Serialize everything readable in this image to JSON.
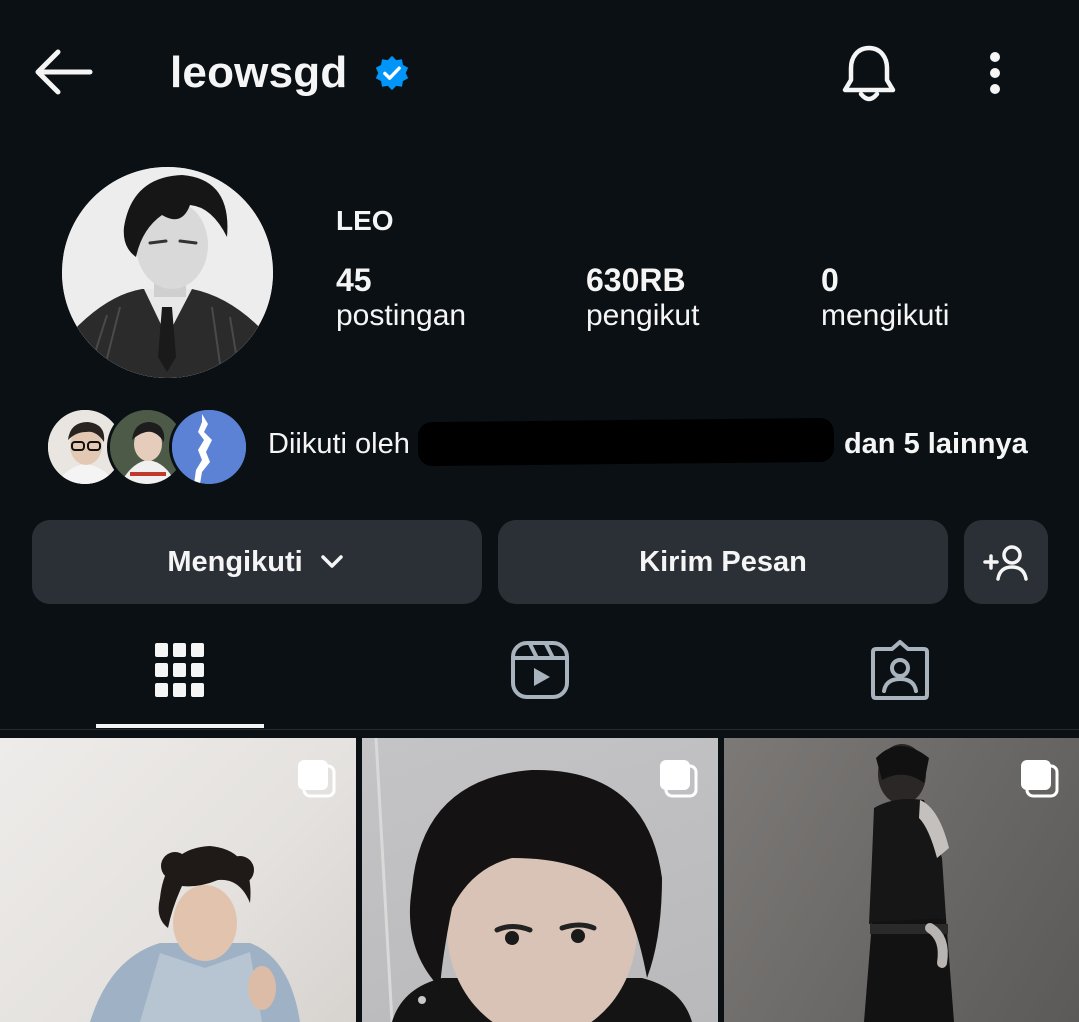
{
  "header": {
    "back_icon": "arrow-left-icon",
    "username": "leowsgd",
    "verified_icon": "verified-badge-icon",
    "verified_color": "#0095f6",
    "bell_icon": "bell-icon",
    "more_icon": "more-vertical-icon"
  },
  "profile": {
    "display_name": "LEO",
    "stats": [
      {
        "value": "45",
        "label": "postingan"
      },
      {
        "value": "630RB",
        "label": "pengikut"
      },
      {
        "value": "0",
        "label": "mengikuti"
      }
    ]
  },
  "followed_by": {
    "prefix": "Diikuti oleh",
    "suffix": "dan 5 lainnya"
  },
  "actions": {
    "follow_label": "Mengikuti",
    "message_label": "Kirim Pesan",
    "add_user_icon": "add-person-icon"
  },
  "tabs": {
    "items": [
      "grid-icon",
      "reels-icon",
      "tagged-icon"
    ],
    "active": 0
  },
  "grid": {
    "posts": [
      {
        "type": "carousel"
      },
      {
        "type": "carousel"
      },
      {
        "type": "carousel"
      }
    ]
  }
}
